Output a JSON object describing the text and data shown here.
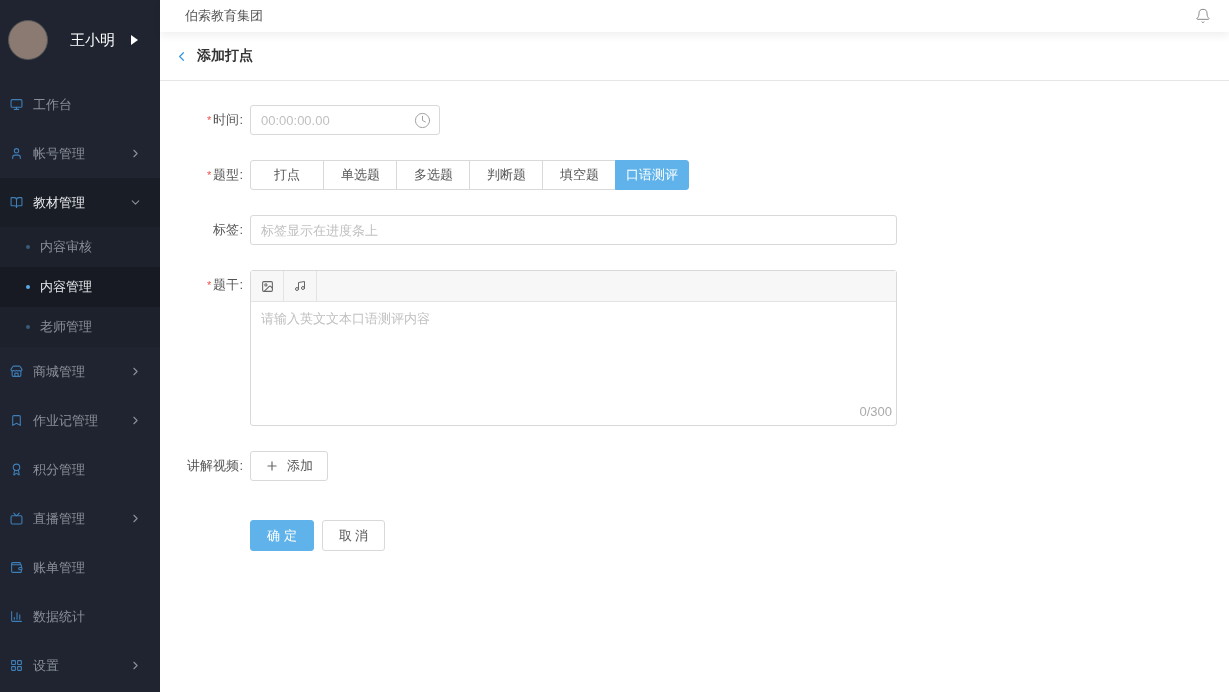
{
  "sidebar": {
    "user": {
      "name": "王小明"
    },
    "items": [
      {
        "kind": "workbench",
        "label": "工作台",
        "has_arrow": false,
        "expanded": false
      },
      {
        "kind": "account",
        "label": "帐号管理",
        "has_arrow": true,
        "expanded": false
      },
      {
        "kind": "book",
        "label": "教材管理",
        "has_arrow": true,
        "expanded": true,
        "children": [
          {
            "label": "内容审核",
            "selected": false
          },
          {
            "label": "内容管理",
            "selected": true
          },
          {
            "label": "老师管理",
            "selected": false
          }
        ]
      },
      {
        "kind": "store",
        "label": "商城管理",
        "has_arrow": true,
        "expanded": false
      },
      {
        "kind": "homework",
        "label": "作业记管理",
        "has_arrow": true,
        "expanded": false
      },
      {
        "kind": "points",
        "label": "积分管理",
        "has_arrow": false,
        "expanded": false
      },
      {
        "kind": "live",
        "label": "直播管理",
        "has_arrow": true,
        "expanded": false
      },
      {
        "kind": "bill",
        "label": "账单管理",
        "has_arrow": false,
        "expanded": false
      },
      {
        "kind": "stats",
        "label": "数据统计",
        "has_arrow": false,
        "expanded": false
      },
      {
        "kind": "settings",
        "label": "设置",
        "has_arrow": true,
        "expanded": false
      }
    ]
  },
  "header": {
    "org": "伯索教育集团"
  },
  "page": {
    "title": "添加打点"
  },
  "form": {
    "time": {
      "label": "时间:",
      "required_mark": "*",
      "placeholder": "00:00:00.00"
    },
    "type": {
      "label": "题型:",
      "required_mark": "*",
      "options": [
        {
          "label": "打点",
          "selected": false
        },
        {
          "label": "单选题",
          "selected": false
        },
        {
          "label": "多选题",
          "selected": false
        },
        {
          "label": "判断题",
          "selected": false
        },
        {
          "label": "填空题",
          "selected": false
        },
        {
          "label": "口语测评",
          "selected": true
        }
      ]
    },
    "tag": {
      "label": "标签:",
      "placeholder": "标签显示在进度条上"
    },
    "stem": {
      "label": "题干:",
      "required_mark": "*",
      "placeholder": "请输入英文文本口语测评内容",
      "counter": "0/300"
    },
    "video": {
      "label": "讲解视频:",
      "button": "添加"
    },
    "buttons": {
      "confirm": "确 定",
      "cancel": "取 消"
    }
  }
}
